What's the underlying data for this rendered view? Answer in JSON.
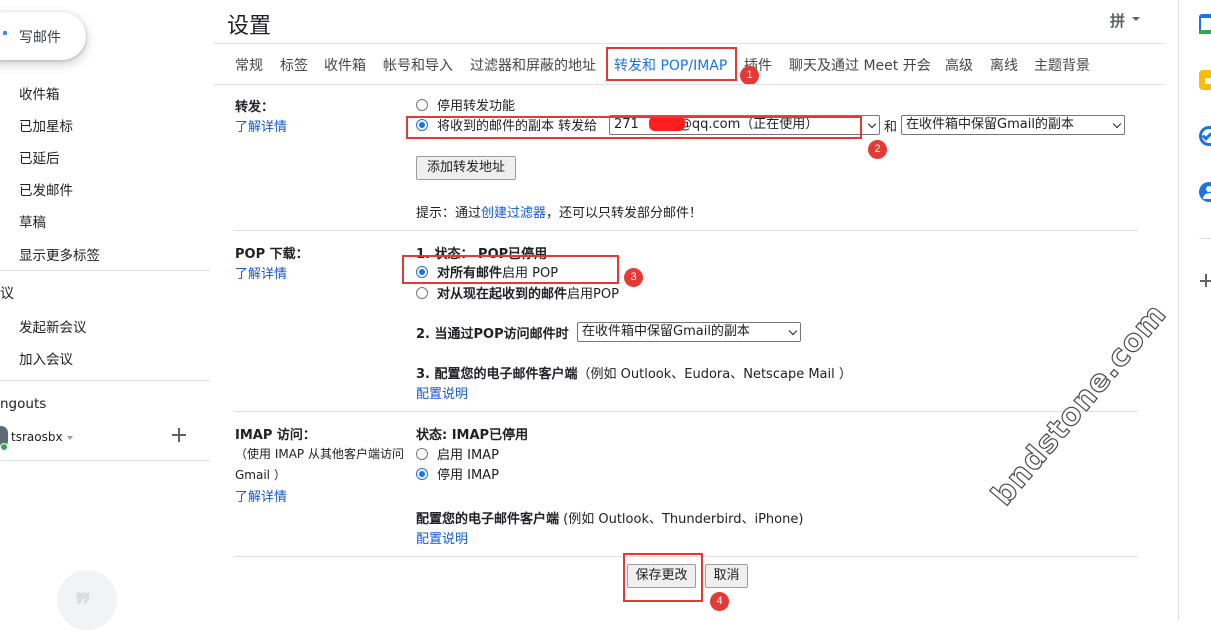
{
  "sidebar": {
    "compose": "写邮件",
    "items": [
      "收件箱",
      "已加星标",
      "已延后",
      "已发邮件",
      "草稿",
      "显示更多标签"
    ],
    "meet_section": "议",
    "meet_items": [
      "发起新会议",
      "加入会议"
    ],
    "hangouts_section": "ngouts",
    "user": "tsraosbx"
  },
  "header": {
    "title": "设置",
    "ime": "拼"
  },
  "tabs": [
    "常规",
    "标签",
    "收件箱",
    "帐号和导入",
    "过滤器和屏蔽的地址",
    "转发和 POP/IMAP",
    "插件",
    "聊天及通过 Meet 开会",
    "高级",
    "离线",
    "主题背景"
  ],
  "badges": [
    "1",
    "2",
    "3",
    "4"
  ],
  "forwarding": {
    "label": "转发：",
    "learn_more": "了解详情",
    "opt_disable": "停用转发功能",
    "opt_forward": "将收到的邮件的副本 转发给",
    "address_prefix": "271",
    "address_suffix": "@qq.com（正在使用）",
    "and": "和",
    "keep_option": "在收件箱中保留Gmail的副本",
    "add_button": "添加转发地址",
    "tip_prefix": "提示：通过",
    "tip_link": "创建过滤器",
    "tip_suffix": "，还可以只转发部分邮件！"
  },
  "pop": {
    "label": "POP 下载：",
    "learn_more": "了解详情",
    "status": "1. 状态： POP已停用",
    "opt_all_bold": "对所有邮件",
    "opt_all_rest": "启用 POP",
    "opt_now_bold": "对从现在起收到的邮件",
    "opt_now_rest": "启用POP",
    "step2": "2. 当通过POP访问邮件时",
    "step2_option": "在收件箱中保留Gmail的副本",
    "step3_bold": "3. 配置您的电子邮件客户端",
    "step3_rest": "（例如 Outlook、Eudora、Netscape Mail ）",
    "config_link": "配置说明"
  },
  "imap": {
    "label": "IMAP 访问：",
    "desc1": "（使用 IMAP 从其他客户端访问",
    "desc2": "Gmail ）",
    "learn_more": "了解详情",
    "status": "状态: IMAP已停用",
    "opt_enable": "启用 IMAP",
    "opt_disable": "停用 IMAP",
    "config_bold": "配置您的电子邮件客户端",
    "config_rest": " (例如 Outlook、Thunderbird、iPhone)",
    "config_link": "配置说明"
  },
  "actions": {
    "save": "保存更改",
    "cancel": "取消"
  },
  "watermark": "bndstone.com",
  "colors": {
    "accent": "#1a73e8",
    "annotation": "#e53935"
  }
}
